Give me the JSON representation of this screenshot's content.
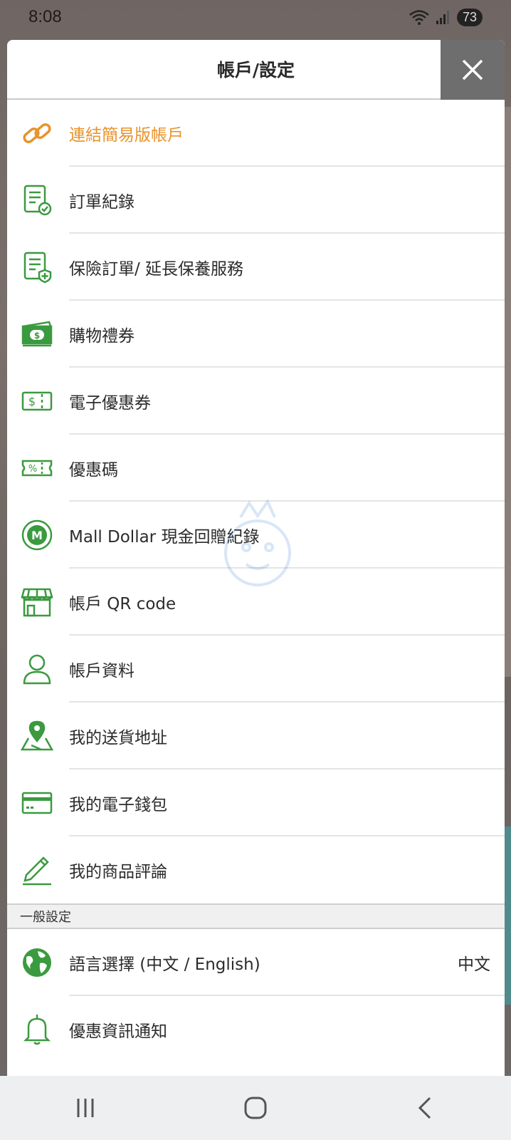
{
  "status_bar": {
    "time": "8:08",
    "battery": "73"
  },
  "panel": {
    "title": "帳戶/設定"
  },
  "menu": [
    {
      "label": "連結簡易版帳戶",
      "icon": "link-icon",
      "accent": true
    },
    {
      "label": "訂單紀錄",
      "icon": "order-record-icon"
    },
    {
      "label": "保險訂單/ 延長保養服務",
      "icon": "insurance-order-icon"
    },
    {
      "label": "購物禮券",
      "icon": "gift-voucher-icon"
    },
    {
      "label": "電子優惠券",
      "icon": "e-coupon-icon"
    },
    {
      "label": "優惠碼",
      "icon": "promo-code-icon"
    },
    {
      "label": "Mall Dollar 現金回贈紀錄",
      "icon": "mall-dollar-icon"
    },
    {
      "label": "帳戶 QR code",
      "icon": "store-icon"
    },
    {
      "label": "帳戶資料",
      "icon": "user-icon"
    },
    {
      "label": "我的送貨地址",
      "icon": "map-pin-icon"
    },
    {
      "label": "我的電子錢包",
      "icon": "credit-card-icon"
    },
    {
      "label": "我的商品評論",
      "icon": "pencil-icon"
    }
  ],
  "general_settings": {
    "header": "一般設定",
    "items": [
      {
        "label": "語言選擇 (中文 / English)",
        "value": "中文",
        "icon": "globe-icon"
      },
      {
        "label": "優惠資訊通知",
        "icon": "bell-icon"
      }
    ]
  },
  "colors": {
    "accent_orange": "#e8932b",
    "icon_green": "#3a9a3f",
    "close_bg": "#6e6e6e"
  }
}
